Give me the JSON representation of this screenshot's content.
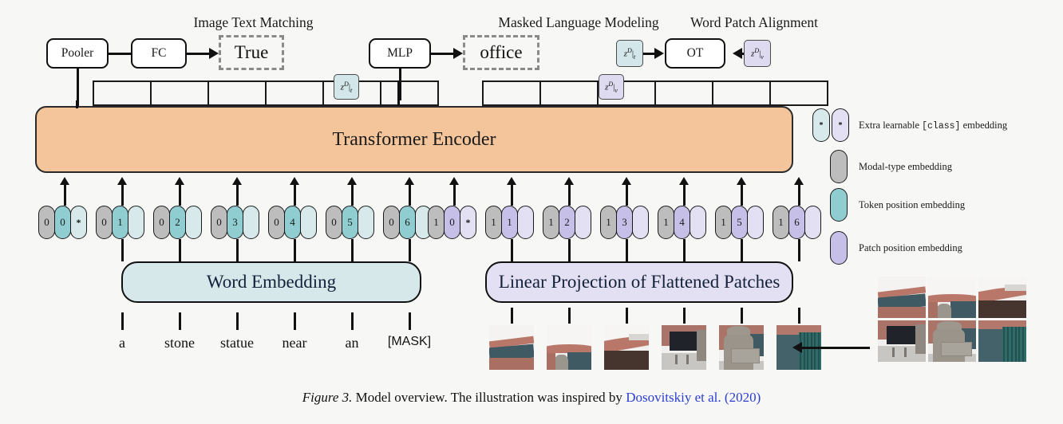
{
  "figure": {
    "caption_num": "Figure 3.",
    "caption_body": " Model overview. The illustration was inspired by ",
    "caption_cite": "Dosovitskiy et al. (2020)"
  },
  "tasks": [
    {
      "title": "Image Text Matching",
      "head_box": "Pooler",
      "mid_box": "FC",
      "output": "True"
    },
    {
      "title": "Masked Language Modeling",
      "head_box": "MLP",
      "output": "office"
    },
    {
      "title": "Word Patch Alignment",
      "box": "OT",
      "left_marker": "z^D|_t",
      "right_marker": "z^D|_v"
    }
  ],
  "z_markers": {
    "text": {
      "symbol": "z",
      "sup": "D",
      "sub": "t"
    },
    "visual": {
      "symbol": "z",
      "sup": "D",
      "sub": "v"
    }
  },
  "encoder": {
    "label": "Transformer Encoder"
  },
  "embeddings": {
    "word": {
      "label": "Word Embedding"
    },
    "patch": {
      "label": "Linear Projection of Flattened Patches"
    }
  },
  "text_tokens": [
    {
      "modal": "0",
      "pos": "0",
      "content": "*"
    },
    {
      "modal": "0",
      "pos": "1",
      "content": "",
      "word": "a"
    },
    {
      "modal": "0",
      "pos": "2",
      "content": "",
      "word": "stone"
    },
    {
      "modal": "0",
      "pos": "3",
      "content": "",
      "word": "statue"
    },
    {
      "modal": "0",
      "pos": "4",
      "content": "",
      "word": "near"
    },
    {
      "modal": "0",
      "pos": "5",
      "content": "",
      "word": "an"
    },
    {
      "modal": "0",
      "pos": "6",
      "content": "",
      "word": "[MASK]"
    }
  ],
  "image_tokens": [
    {
      "modal": "1",
      "pos": "0",
      "content": "*"
    },
    {
      "modal": "1",
      "pos": "1",
      "content": ""
    },
    {
      "modal": "1",
      "pos": "2",
      "content": ""
    },
    {
      "modal": "1",
      "pos": "3",
      "content": ""
    },
    {
      "modal": "1",
      "pos": "4",
      "content": ""
    },
    {
      "modal": "1",
      "pos": "5",
      "content": ""
    },
    {
      "modal": "1",
      "pos": "6",
      "content": ""
    }
  ],
  "words": [
    "a",
    "stone",
    "statue",
    "near",
    "an",
    "[MASK]"
  ],
  "legend": [
    {
      "name": "extra-learnable-class",
      "label_pre": "Extra learnable ",
      "label_code": "[class]",
      "label_post": " embedding",
      "swatches": [
        "#d7e9ea",
        "#e3e0f4"
      ],
      "glyph": "*"
    },
    {
      "name": "modal-type",
      "label_pre": "Modal-type embedding",
      "label_code": "",
      "label_post": "",
      "swatches": [
        "#bdbdbd"
      ],
      "glyph": ""
    },
    {
      "name": "token-position",
      "label_pre": "Token position embedding",
      "label_code": "",
      "label_post": "",
      "swatches": [
        "#8fcdd0"
      ],
      "glyph": ""
    },
    {
      "name": "patch-position",
      "label_pre": "Patch position embedding",
      "label_code": "",
      "label_post": "",
      "swatches": [
        "#c6bfe8"
      ],
      "glyph": ""
    }
  ],
  "colors": {
    "encoder_fill": "#f4c49a",
    "word_embedding_fill": "#d6e8ea",
    "patch_projection_fill": "#e2e0f2",
    "modal_type": "#bdbdbd",
    "token_position": "#8fcdd0",
    "patch_position": "#c6bfe8",
    "citation_link": "#2b3fd0",
    "background": "#f7f7f5"
  }
}
